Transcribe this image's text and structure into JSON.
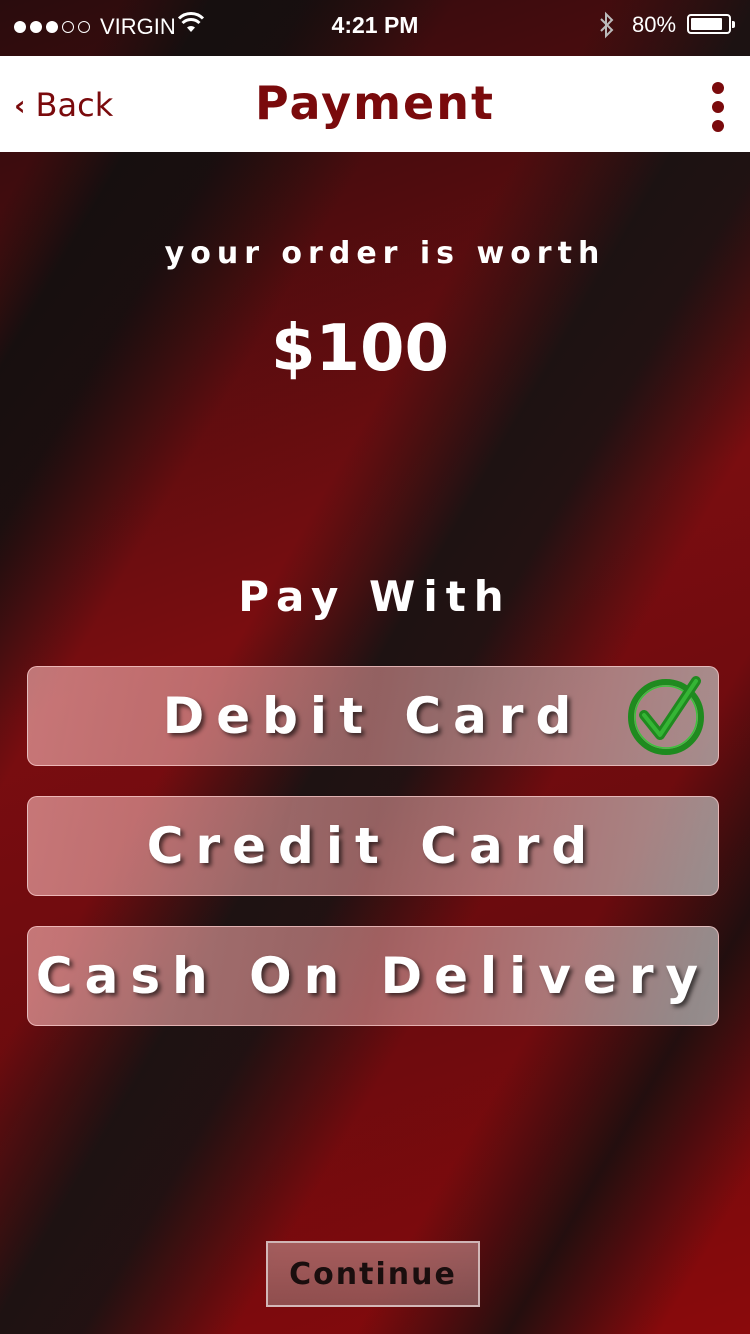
{
  "status_bar": {
    "carrier": "VIRGIN",
    "signal_bars_filled": 3,
    "signal_bars_total": 5,
    "time": "4:21 PM",
    "battery_percent": "80%"
  },
  "nav": {
    "back_label": "Back",
    "title": "Payment",
    "menu_icon": "more-vertical-icon"
  },
  "order": {
    "label": "your order is worth",
    "amount": "$100"
  },
  "pay_with": {
    "label": "Pay With",
    "options": [
      {
        "label": "Debit Card",
        "selected": true
      },
      {
        "label": "Credit Card",
        "selected": false
      },
      {
        "label": "Cash On Delivery",
        "selected": false
      }
    ]
  },
  "continue_label": "Continue",
  "colors": {
    "accent": "#7a0a0c",
    "check_green": "#1f8a1f"
  }
}
